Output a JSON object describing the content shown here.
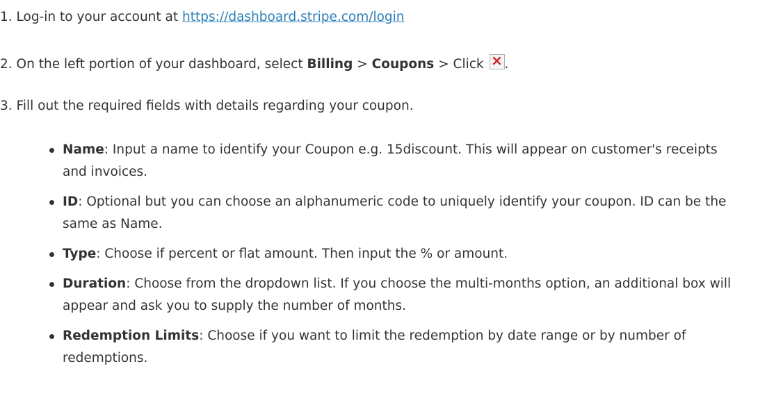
{
  "steps": [
    {
      "num": "1.",
      "text": "Log-in to your account at",
      "link": "https://dashboard.stripe.com/login"
    },
    {
      "num": "2.",
      "pre": "On the left portion of your dashboard, select",
      "billing": "Billing",
      "sep1": ">",
      "coupons": "Coupons",
      "sep2": ">",
      "click": "Click",
      "end": "."
    },
    {
      "num": "3.",
      "text": "Fill out the required fields with details regarding your coupon."
    }
  ],
  "fields": [
    {
      "term": "Name",
      "desc": ": Input a name to identify your Coupon e.g. 15discount. This will appear on customer's receipts and invoices."
    },
    {
      "term": "ID",
      "desc": ": Optional but you can choose an alphanumeric code to uniquely identify your coupon. ID can be the same as Name."
    },
    {
      "term": "Type",
      "desc": ": Choose if percent or flat amount. Then input the % or amount."
    },
    {
      "term": "Duration",
      "desc": ": Choose from the dropdown list. If you choose the multi-months option, an additional box will appear and ask you to supply the number of months."
    },
    {
      "term": "Redemption Limits",
      "desc": ": Choose if you want to limit the redemption by date range or by number of redemptions."
    }
  ],
  "colors": {
    "text": "#333333",
    "link": "#2a7fb8",
    "broken_image_x": "#d42020"
  },
  "icons": {
    "step2_inline": "broken-image-icon"
  }
}
